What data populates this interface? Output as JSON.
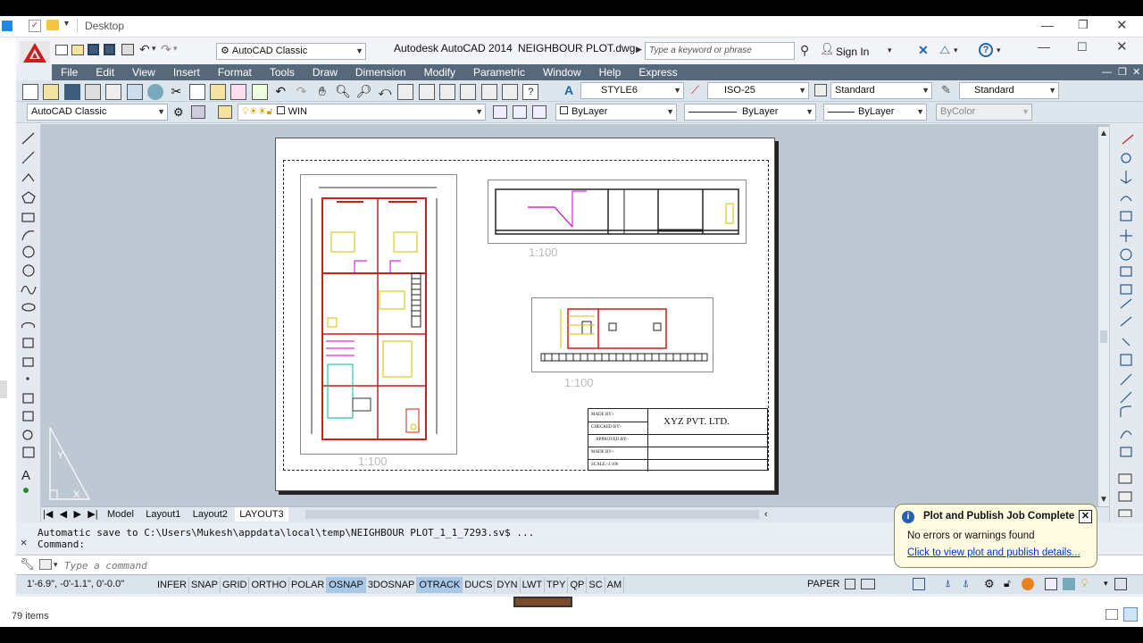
{
  "explorer": {
    "address": "Desktop",
    "status": "79 items"
  },
  "window": {
    "app_title": "Autodesk AutoCAD 2014",
    "file_name": "NEIGHBOUR PLOT.dwg",
    "search_placeholder": "Type a keyword or phrase",
    "sign_in": "Sign In",
    "workspace_quick": "AutoCAD Classic"
  },
  "menu": [
    "File",
    "Edit",
    "View",
    "Insert",
    "Format",
    "Tools",
    "Draw",
    "Dimension",
    "Modify",
    "Parametric",
    "Window",
    "Help",
    "Express"
  ],
  "styles": {
    "text_style": "STYLE6",
    "dim_style": "ISO-25",
    "table_style": "Standard",
    "multileader_style": "Standard"
  },
  "layers": {
    "workspace": "AutoCAD Classic",
    "layer": "WIN",
    "color": "ByLayer",
    "linetype": "ByLayer",
    "lineweight": "ByLayer",
    "plotstyle": "ByColor"
  },
  "drawing": {
    "scale_plan": "1:100",
    "scale_elevation": "1:100",
    "scale_section": "1:100",
    "title_block": {
      "company": "XYZ PVT. LTD.",
      "made_by": "MADE BY:-",
      "checked_by": "CHECKED BY:-",
      "approved_by": "APPROVED BY:-",
      "made_by_2": "MADE BY:-",
      "scale": "SCALE:-1:100"
    }
  },
  "tabs": {
    "model": "Model",
    "layout1": "Layout1",
    "layout2": "Layout2",
    "layout3": "LAYOUT3"
  },
  "command": {
    "history_1": "Automatic save to C:\\Users\\Mukesh\\appdata\\local\\temp\\NEIGHBOUR PLOT_1_1_7293.sv$ ...",
    "history_2": "Command:",
    "placeholder": "Type a command"
  },
  "status": {
    "coords": "1'-6.9\", -0'-1.1\", 0'-0.0\"",
    "toggles": [
      {
        "label": "INFER",
        "on": false
      },
      {
        "label": "SNAP",
        "on": false
      },
      {
        "label": "GRID",
        "on": false
      },
      {
        "label": "ORTHO",
        "on": false
      },
      {
        "label": "POLAR",
        "on": false
      },
      {
        "label": "OSNAP",
        "on": true
      },
      {
        "label": "3DOSNAP",
        "on": false
      },
      {
        "label": "OTRACK",
        "on": true
      },
      {
        "label": "DUCS",
        "on": false
      },
      {
        "label": "DYN",
        "on": false
      },
      {
        "label": "LWT",
        "on": false
      },
      {
        "label": "TPY",
        "on": false
      },
      {
        "label": "QP",
        "on": false
      },
      {
        "label": "SC",
        "on": false
      },
      {
        "label": "AM",
        "on": false
      }
    ],
    "space": "PAPER"
  },
  "notification": {
    "title": "Plot and Publish Job Complete",
    "message": "No errors or warnings found",
    "link": "Click to view plot and publish details..."
  },
  "colors": {
    "menubar": "#56687a",
    "drawarea": "#bec8d2",
    "acad_red": "#c8201e",
    "toggle_on": "#a8c8e8"
  }
}
